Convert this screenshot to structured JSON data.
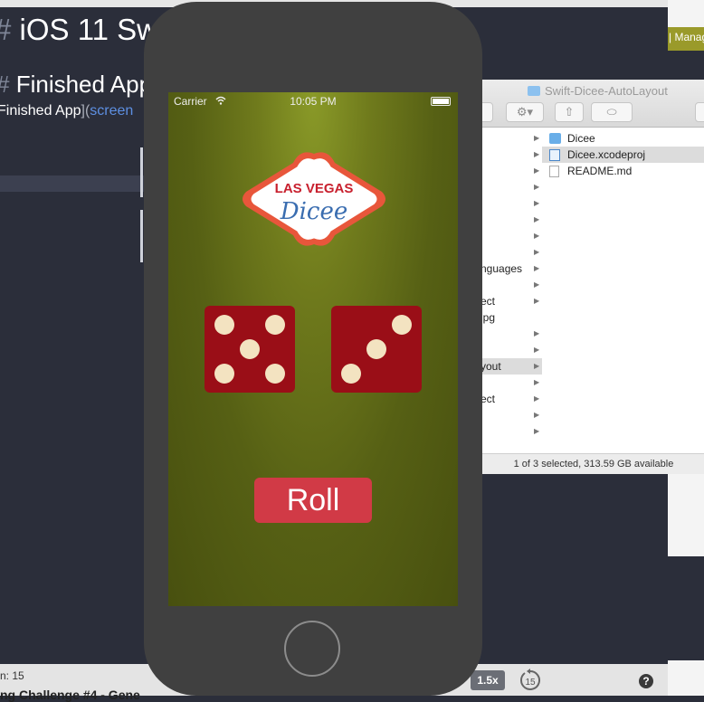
{
  "editor": {
    "h1_hash": "#",
    "h1_text": "iOS 11 Sw",
    "h2_hash": "#",
    "h2_text": "Finished App",
    "line_text": "Finished App",
    "line_link_open": "](",
    "line_link": "screen",
    "status_line": "n: 15",
    "status_doc": "ng Challenge #4 - Gene"
  },
  "right_strip": {
    "label": "| Manag"
  },
  "video_controls": {
    "speed": "1.5x",
    "skip_seconds": "15",
    "help": "?"
  },
  "finder": {
    "title": "Swift-Dicee-AutoLayout",
    "gear": "⚙▾",
    "share": "⇧",
    "tag": "⬭",
    "left_column": [
      {
        "label": "",
        "arrow": "▶"
      },
      {
        "label": "",
        "arrow": "▶"
      },
      {
        "label": "",
        "arrow": "▶"
      },
      {
        "label": "",
        "arrow": "▶"
      },
      {
        "label": "",
        "arrow": "▶"
      },
      {
        "label": "",
        "arrow": "▶"
      },
      {
        "label": "",
        "arrow": "▶"
      },
      {
        "label": "",
        "arrow": "▶"
      },
      {
        "label": "nguages",
        "arrow": "▶"
      },
      {
        "label": "",
        "arrow": "▶"
      },
      {
        "label": "ect",
        "arrow": "▶"
      },
      {
        "label": "jpg",
        "arrow": ""
      },
      {
        "label": "",
        "arrow": "▶"
      },
      {
        "label": "",
        "arrow": "▶"
      },
      {
        "label": "yout",
        "arrow": "▶"
      },
      {
        "label": "",
        "arrow": "▶"
      },
      {
        "label": "ect",
        "arrow": "▶"
      },
      {
        "label": "",
        "arrow": "▶"
      },
      {
        "label": "",
        "arrow": "▶"
      }
    ],
    "files": [
      {
        "name": "Dicee",
        "icon": "folder-icon"
      },
      {
        "name": "Dicee.xcodeproj",
        "icon": "xcodeproj-icon"
      },
      {
        "name": "README.md",
        "icon": "markdown-file-icon"
      }
    ],
    "status": "1 of 3 selected, 313.59 GB available"
  },
  "simulator": {
    "carrier": "Carrier",
    "time": "10:05 PM",
    "logo_line1": "LAS VEGAS",
    "logo_line2": "Dicee",
    "die_left_value": 5,
    "die_right_value": 3,
    "roll_label": "Roll",
    "colors": {
      "felt": "#5f6a17",
      "die": "#9a0e17",
      "pip": "#f3e3c1",
      "roll_button": "#d13a46"
    }
  }
}
